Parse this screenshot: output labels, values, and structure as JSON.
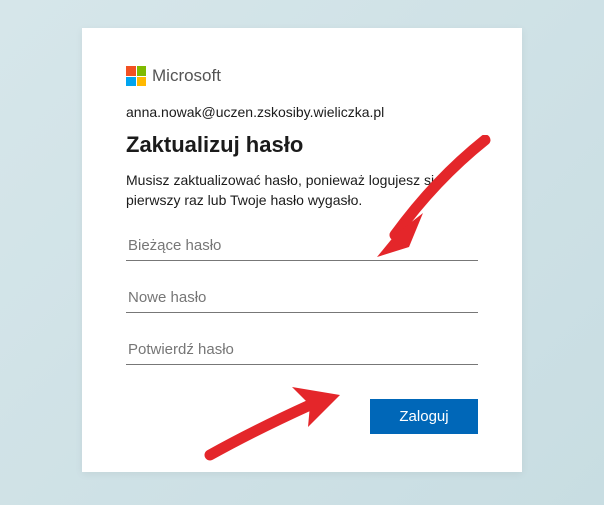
{
  "brand": {
    "name": "Microsoft"
  },
  "user": {
    "email": "anna.nowak@uczen.zskosiby.wieliczka.pl"
  },
  "page": {
    "title": "Zaktualizuj hasło",
    "description": "Musisz zaktualizować hasło, ponieważ logujesz się pierwszy raz lub Twoje hasło wygasło."
  },
  "fields": {
    "current_password_placeholder": "Bieżące hasło",
    "new_password_placeholder": "Nowe hasło",
    "confirm_password_placeholder": "Potwierdź hasło"
  },
  "actions": {
    "submit_label": "Zaloguj"
  },
  "colors": {
    "accent": "#0067b8"
  }
}
